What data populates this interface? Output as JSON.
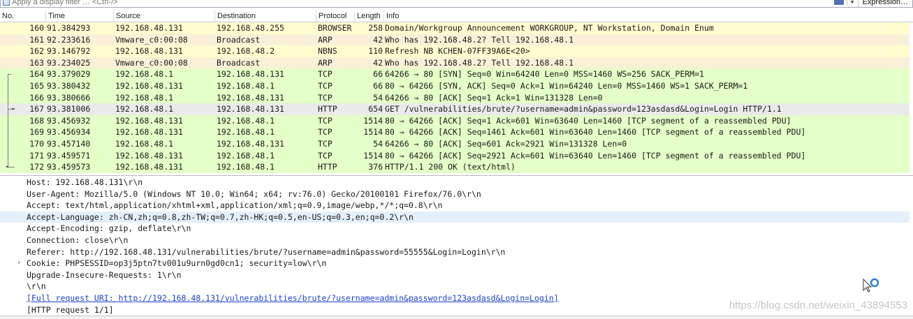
{
  "filter": {
    "placeholder": "Apply a display filter … <Ctrl-/>",
    "expression_label": "Expression…"
  },
  "columns": [
    "No.",
    "Time",
    "Source",
    "Destination",
    "Protocol",
    "Length",
    "Info"
  ],
  "colors": {
    "browser_row": "#fefdd0",
    "arp_row": "#faf0d7",
    "tcp_row": "#e4ffc7",
    "selected_row": "#eaeaea",
    "highlight_line": "#e3f0fb",
    "link": "#1c3fd0"
  },
  "packets": [
    {
      "no": "160",
      "time": "91.384293",
      "src": "192.168.48.131",
      "dst": "192.168.48.255",
      "proto": "BROWSER",
      "len": "258",
      "info": "Domain/Workgroup Announcement WORKGROUP, NT Workstation, Domain Enum",
      "bg": "#fefdd0"
    },
    {
      "no": "161",
      "time": "92.233616",
      "src": "Vmware_c0:00:08",
      "dst": "Broadcast",
      "proto": "ARP",
      "len": "42",
      "info": "Who has 192.168.48.2? Tell 192.168.48.1",
      "bg": "#faf0d7"
    },
    {
      "no": "162",
      "time": "93.146792",
      "src": "192.168.48.131",
      "dst": "192.168.48.2",
      "proto": "NBNS",
      "len": "110",
      "info": "Refresh NB KCHEN-07FF39A6E<20>",
      "bg": "#fefdd0"
    },
    {
      "no": "163",
      "time": "93.234025",
      "src": "Vmware_c0:00:08",
      "dst": "Broadcast",
      "proto": "ARP",
      "len": "42",
      "info": "Who has 192.168.48.2? Tell 192.168.48.1",
      "bg": "#faf0d7"
    },
    {
      "no": "164",
      "time": "93.379029",
      "src": "192.168.48.1",
      "dst": "192.168.48.131",
      "proto": "TCP",
      "len": "66",
      "info": "64266 → 80 [SYN] Seq=0 Win=64240 Len=0 MSS=1460 WS=256 SACK_PERM=1",
      "bg": "#e4ffc7"
    },
    {
      "no": "165",
      "time": "93.380432",
      "src": "192.168.48.131",
      "dst": "192.168.48.1",
      "proto": "TCP",
      "len": "66",
      "info": "80 → 64266 [SYN, ACK] Seq=0 Ack=1 Win=64240 Len=0 MSS=1460 WS=1 SACK_PERM=1",
      "bg": "#e4ffc7"
    },
    {
      "no": "166",
      "time": "93.380666",
      "src": "192.168.48.1",
      "dst": "192.168.48.131",
      "proto": "TCP",
      "len": "54",
      "info": "64266 → 80 [ACK] Seq=1 Ack=1 Win=131328 Len=0",
      "bg": "#e4ffc7"
    },
    {
      "no": "167",
      "time": "93.381006",
      "src": "192.168.48.1",
      "dst": "192.168.48.131",
      "proto": "HTTP",
      "len": "654",
      "info": "GET /vulnerabilities/brute/?username=admin&password=123asdasd&Login=Login HTTP/1.1",
      "bg": "#eaeaea"
    },
    {
      "no": "168",
      "time": "93.456932",
      "src": "192.168.48.131",
      "dst": "192.168.48.1",
      "proto": "TCP",
      "len": "1514",
      "info": "80 → 64266 [ACK] Seq=1 Ack=601 Win=63640 Len=1460 [TCP segment of a reassembled PDU]",
      "bg": "#e4ffc7"
    },
    {
      "no": "169",
      "time": "93.456934",
      "src": "192.168.48.131",
      "dst": "192.168.48.1",
      "proto": "TCP",
      "len": "1514",
      "info": "80 → 64266 [ACK] Seq=1461 Ack=601 Win=63640 Len=1460 [TCP segment of a reassembled PDU]",
      "bg": "#e4ffc7"
    },
    {
      "no": "170",
      "time": "93.457140",
      "src": "192.168.48.1",
      "dst": "192.168.48.131",
      "proto": "TCP",
      "len": "54",
      "info": "64266 → 80 [ACK] Seq=601 Ack=2921 Win=131328 Len=0",
      "bg": "#e4ffc7"
    },
    {
      "no": "171",
      "time": "93.459571",
      "src": "192.168.48.131",
      "dst": "192.168.48.1",
      "proto": "TCP",
      "len": "1514",
      "info": "80 → 64266 [ACK] Seq=2921 Ack=601 Win=63640 Len=1460 [TCP segment of a reassembled PDU]",
      "bg": "#e4ffc7"
    },
    {
      "no": "172",
      "time": "93.459573",
      "src": "192.168.48.131",
      "dst": "192.168.48.1",
      "proto": "HTTP",
      "len": "376",
      "info": "HTTP/1.1 200 OK  (text/html)",
      "bg": "#e4ffc7"
    }
  ],
  "details": [
    {
      "text": "Host: 192.168.48.131\\r\\n"
    },
    {
      "text": "User-Agent: Mozilla/5.0 (Windows NT 10.0; Win64; x64; rv:76.0) Gecko/20100101 Firefox/76.0\\r\\n"
    },
    {
      "text": "Accept: text/html,application/xhtml+xml,application/xml;q=0.9,image/webp,*/*;q=0.8\\r\\n"
    },
    {
      "text": "Accept-Language: zh-CN,zh;q=0.8,zh-TW;q=0.7,zh-HK;q=0.5,en-US;q=0.3,en;q=0.2\\r\\n",
      "highlight": true
    },
    {
      "text": "Accept-Encoding: gzip, deflate\\r\\n"
    },
    {
      "text": "Connection: close\\r\\n"
    },
    {
      "text": "Referer: http://192.168.48.131/vulnerabilities/brute/?username=admin&password=55555&Login=Login\\r\\n"
    },
    {
      "text": "Cookie: PHPSESSID=op3j5ptn7tv001u9urn0gd0cn1; security=low\\r\\n",
      "expander": "›"
    },
    {
      "text": "Upgrade-Insecure-Requests: 1\\r\\n"
    },
    {
      "text": "\\r\\n"
    },
    {
      "text": "[Full request URI: http://192.168.48.131/vulnerabilities/brute/?username=admin&password=123asdasd&Login=Login]",
      "link": true
    },
    {
      "text": "[HTTP request 1/1]"
    }
  ],
  "watermark": "https://blog.csdn.net/weixin_43894553"
}
